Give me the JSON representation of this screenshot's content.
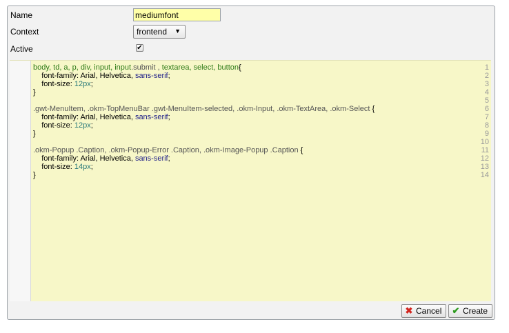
{
  "form": {
    "name_label": "Name",
    "name_value": "mediumfont",
    "context_label": "Context",
    "context_value": "frontend",
    "active_label": "Active",
    "active_checked": true
  },
  "editor": {
    "line_numbers": [
      "1",
      "2",
      "3",
      "4",
      "5",
      "6",
      "7",
      "8",
      "9",
      "10",
      "11",
      "12",
      "13",
      "14"
    ],
    "code": {
      "l1_kw": "body, td, a, p, div, input, input",
      "l1_cls": ".submit , ",
      "l1_kw2": "textarea, select, button",
      "l1_brace": "{",
      "l2_prop": "    font-family: Arial, Helvetica, ",
      "l2_val": "sans-serif",
      "l2_end": ";",
      "l3_prop": "    font-size: ",
      "l3_val": "12px",
      "l3_end": ";",
      "l4": "}",
      "l6_cls": ".gwt-MenuItem, .okm-TopMenuBar .gwt-MenuItem-selected, .okm-Input, .okm-TextArea, .okm-Select ",
      "l6_brace": "{",
      "l7_prop": "    font-family: Arial, Helvetica, ",
      "l7_val": "sans-serif",
      "l7_end": ";",
      "l8_prop": "    font-size: ",
      "l8_val": "12px",
      "l8_end": ";",
      "l9": "}",
      "l11_cls": ".okm-Popup .Caption, .okm-Popup-Error .Caption, .okm-Image-Popup .Caption ",
      "l11_brace": "{",
      "l12_prop": "    font-family: Arial, Helvetica, ",
      "l12_val": "sans-serif",
      "l12_end": ";",
      "l13_prop": "    font-size: ",
      "l13_val": "14px",
      "l13_end": ";",
      "l14": "}"
    }
  },
  "buttons": {
    "cancel_label": "Cancel",
    "create_label": "Create"
  },
  "icons": {
    "cancel": "cancel-x-icon",
    "create": "check-icon",
    "dropdown": "dropdown-arrow-icon",
    "checkbox": "checkmark-icon"
  },
  "colors": {
    "name_field_bg": "#ffffa8",
    "editor_bg": "#f7f7c8",
    "keyword": "#2d7a16",
    "value": "#1d1d88"
  }
}
